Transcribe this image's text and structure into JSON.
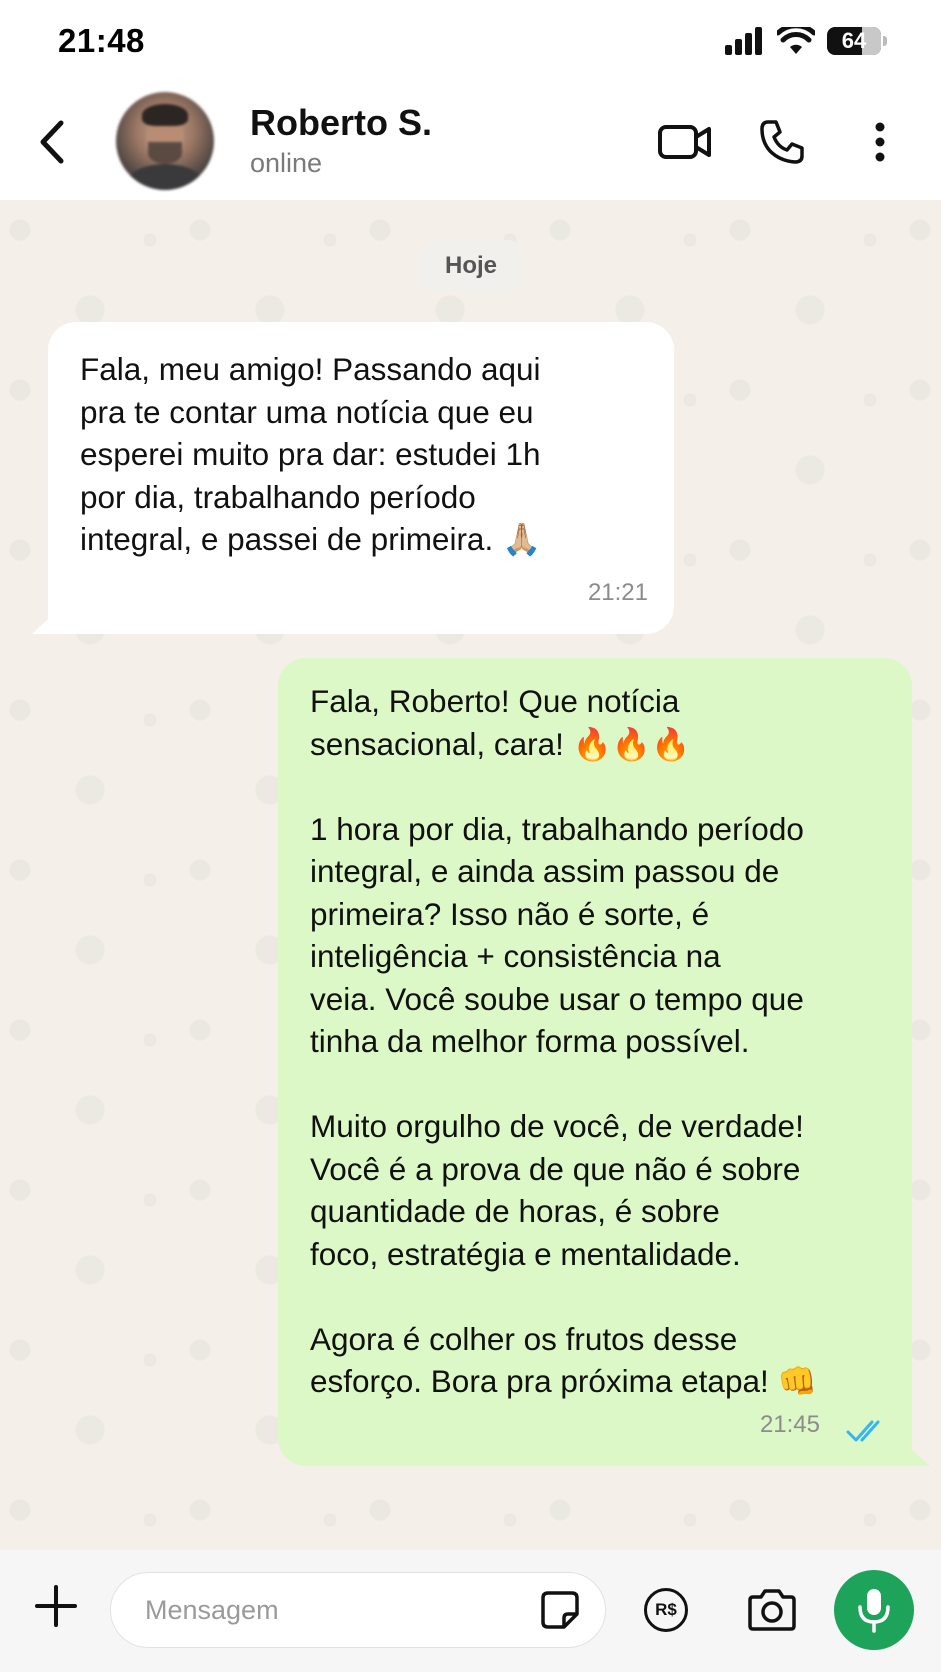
{
  "status_bar": {
    "time": "21:48",
    "battery": "64",
    "icons": [
      "signal-icon",
      "wifi-icon",
      "battery-icon"
    ]
  },
  "header": {
    "contact_name": "Roberto S.",
    "contact_status": "online",
    "icons": [
      "back-icon",
      "video-call-icon",
      "phone-icon",
      "more-vertical-icon"
    ]
  },
  "chat": {
    "date_label": "Hoje",
    "messages": [
      {
        "direction": "incoming",
        "text": "Fala, meu amigo! Passando aqui\npra te contar uma notícia que eu\nesperei muito pra dar: estudei 1h\npor dia, trabalhando período\nintegral, e passei de primeira. 🙏🏼",
        "time": "21:21"
      },
      {
        "direction": "outgoing",
        "text": "Fala, Roberto! Que notícia\nsensacional, cara! 🔥🔥🔥\n\n1 hora por dia, trabalhando período\nintegral, e ainda assim passou de\nprimeira? Isso não é sorte, é\ninteligência + consistência na\nveia. Você soube usar o tempo que\ntinha da melhor forma possível.\n\nMuito orgulho de você, de verdade!\nVocê é a prova de que não é sobre\nquantidade de horas, é sobre\nfoco, estratégia e mentalidade.\n\nAgora é colher os frutos desse\nesforço. Bora pra próxima etapa! 👊",
        "time": "21:45",
        "status": "read"
      }
    ]
  },
  "input_bar": {
    "placeholder": "Mensagem",
    "value": "",
    "pix_label": "R$",
    "icons": [
      "plus-icon",
      "sticker-icon",
      "pix-icon",
      "camera-icon",
      "mic-icon"
    ]
  },
  "colors": {
    "incoming_bubble": "#ffffff",
    "outgoing_bubble": "#dcf8c6",
    "chat_background": "#f4efe9",
    "read_receipt": "#34b7f1",
    "mic_button": "#1ea35b"
  }
}
